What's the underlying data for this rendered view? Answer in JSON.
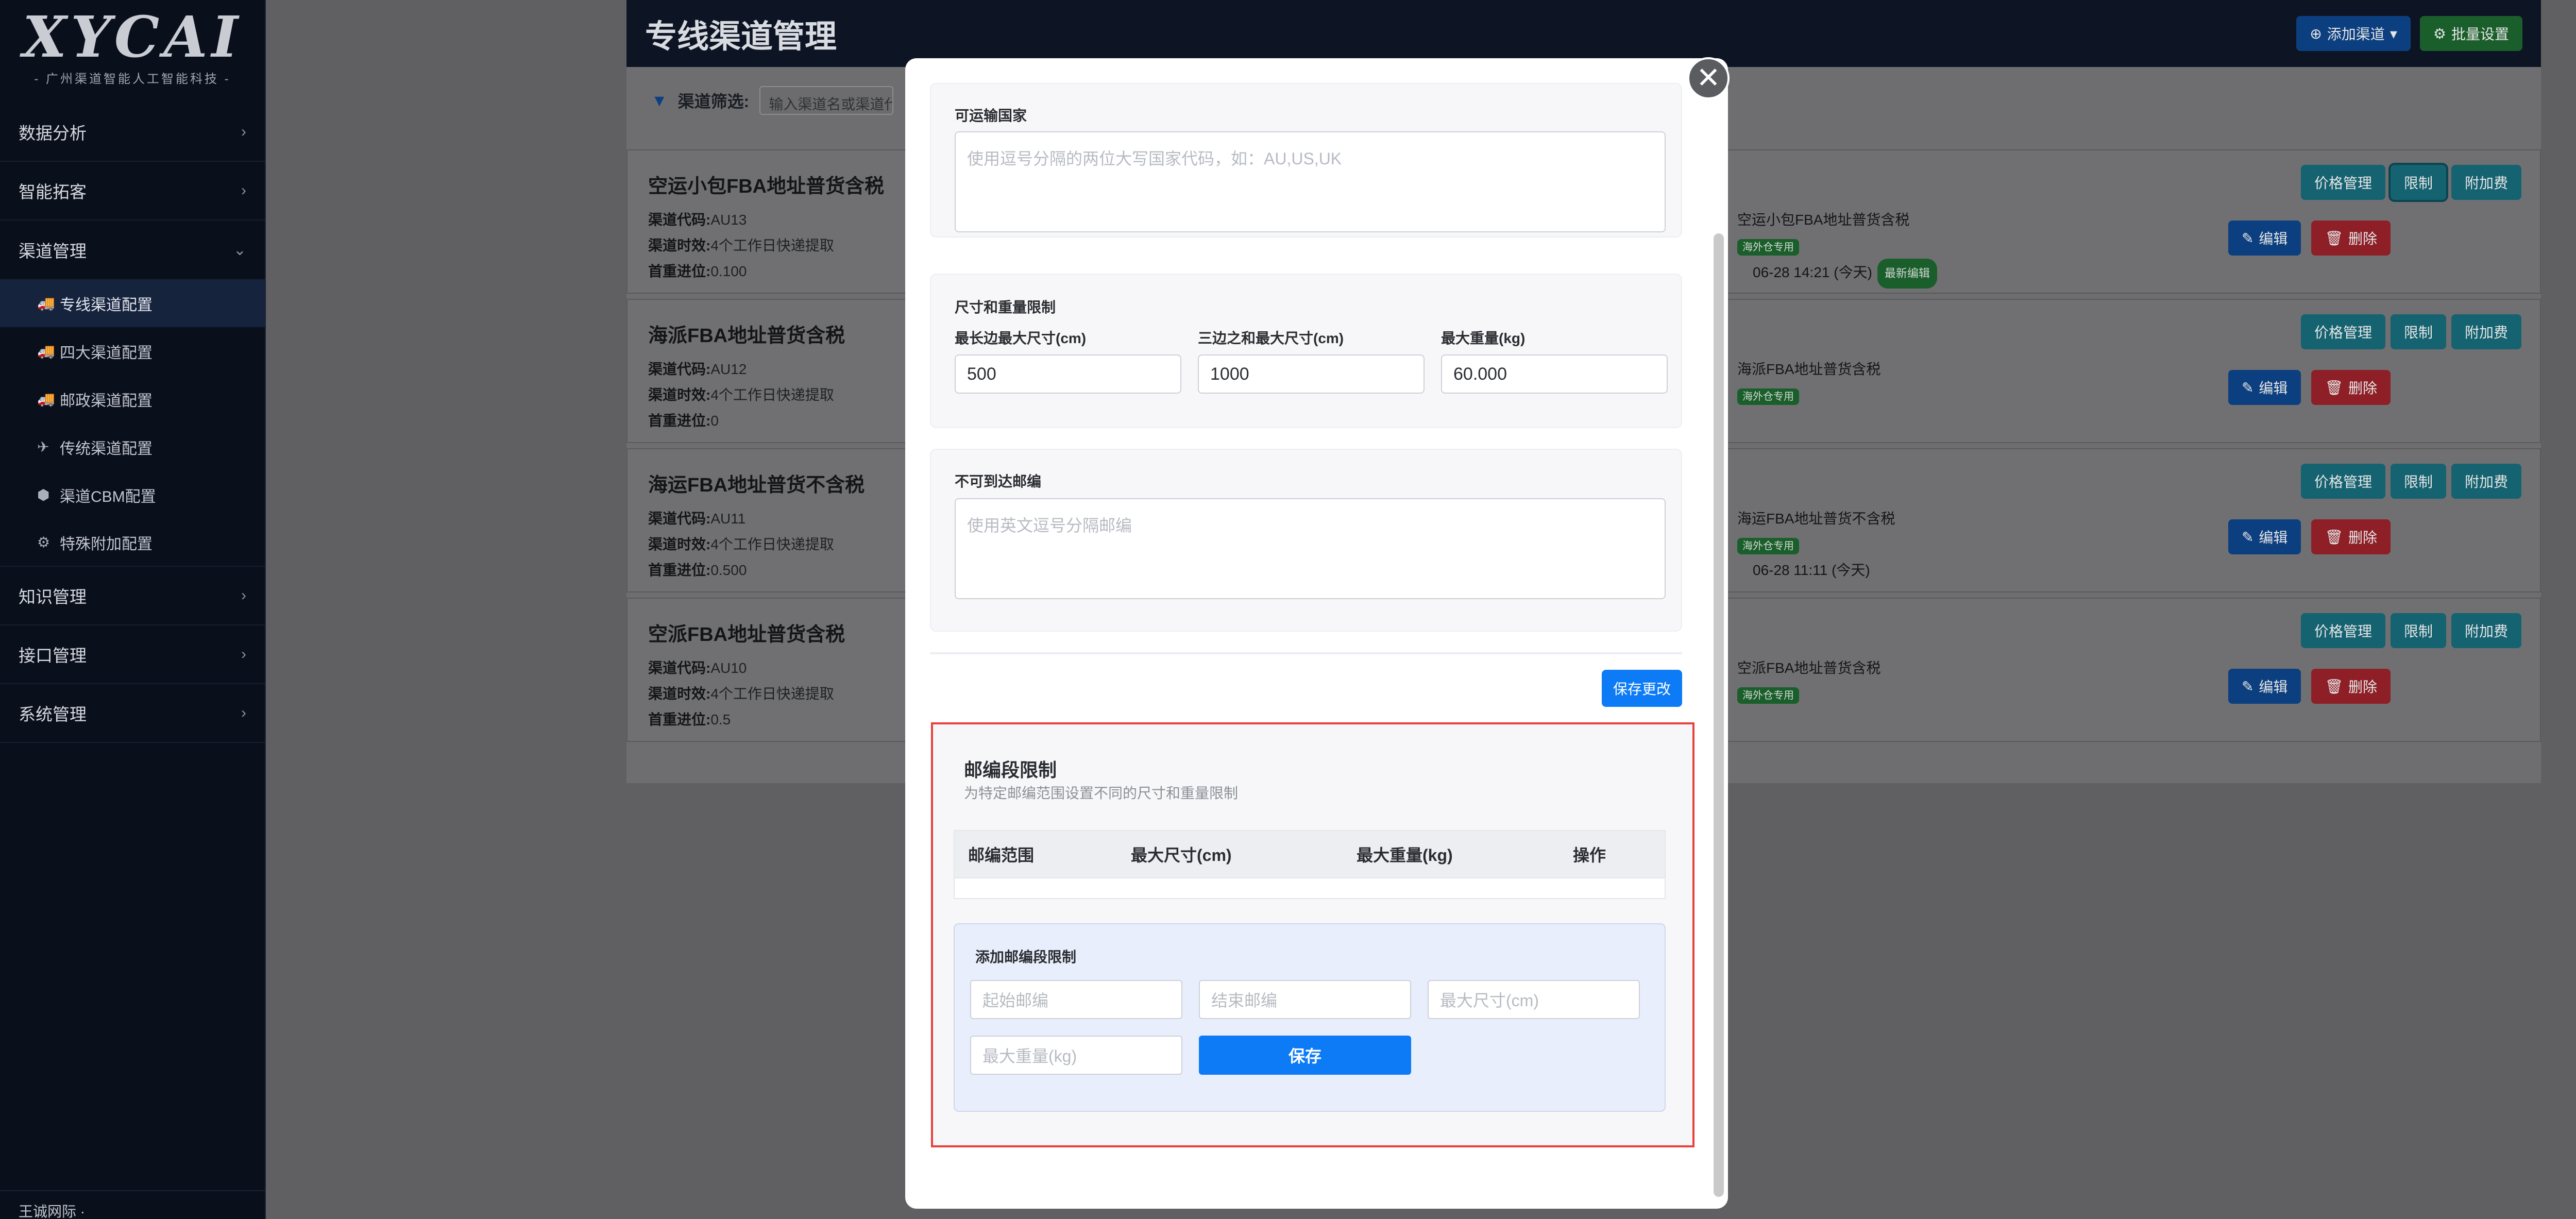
{
  "sidebar": {
    "logo_text": "XYCAI",
    "logo_sub": "- 广州渠道智能人工智能科技 -",
    "menu": [
      {
        "label": "数据分析",
        "chev": "›"
      },
      {
        "label": "智能拓客",
        "chev": "›"
      },
      {
        "label": "渠道管理",
        "chev": "⌄"
      }
    ],
    "submenu": [
      {
        "label": "专线渠道配置",
        "icon": "🚚"
      },
      {
        "label": "四大渠道配置",
        "icon": "🚚"
      },
      {
        "label": "邮政渠道配置",
        "icon": "🚚"
      },
      {
        "label": "传统渠道配置",
        "icon": "✈"
      },
      {
        "label": "渠道CBM配置",
        "icon": "⬢"
      },
      {
        "label": "特殊附加配置",
        "icon": "⚙"
      }
    ],
    "menu2": [
      {
        "label": "知识管理",
        "chev": "›"
      },
      {
        "label": "接口管理",
        "chev": "›"
      },
      {
        "label": "系统管理",
        "chev": "›"
      }
    ],
    "footer": "王诚网际 ·"
  },
  "page": {
    "title": "专线渠道管理",
    "add_channel": "添加渠道",
    "batch_settings": "批量设置",
    "filter_label": "渠道筛选:",
    "filter_placeholder": "输入渠道名或渠道代"
  },
  "cards": [
    {
      "title": "空运小包FBA地址普货含税",
      "code": "AU13",
      "time": "4个工作日快递提取",
      "weight": "0.100",
      "right_name": "空运小包FBA地址普货含税",
      "right_badge": "海外仓专用",
      "right_time": "06-28 14:21 (今天)",
      "right_latest": "最新编辑"
    },
    {
      "title": "海派FBA地址普货含税",
      "code": "AU12",
      "time": "4个工作日快递提取",
      "weight": "0",
      "right_name": "海派FBA地址普货含税",
      "right_badge": "海外仓专用",
      "right_time": "",
      "right_latest": ""
    },
    {
      "title": "海运FBA地址普货不含税",
      "code": "AU11",
      "time": "4个工作日快递提取",
      "weight": "0.500",
      "right_name": "海运FBA地址普货不含税",
      "right_badge": "海外仓专用",
      "right_time": "06-28 11:11 (今天)",
      "right_latest": ""
    },
    {
      "title": "空派FBA地址普货含税",
      "code": "AU10",
      "time": "4个工作日快递提取",
      "weight": "0.5",
      "right_name": "空派FBA地址普货含税",
      "right_badge": "海外仓专用",
      "right_time": "",
      "right_latest": ""
    }
  ],
  "card_labels": {
    "code": "渠道代码:",
    "time": "渠道时效:",
    "weight": "首重进位:",
    "price_mgmt": "价格管理",
    "limit": "限制",
    "surcharge": "附加费",
    "edit": "编辑",
    "delete": "删除"
  },
  "modal": {
    "close": "✕",
    "countries_label": "可运输国家",
    "countries_placeholder": "使用逗号分隔的两位大写国家代码，如：AU,US,UK",
    "size_section_label": "尺寸和重量限制",
    "max_side_label": "最长边最大尺寸(cm)",
    "max_side_value": "500",
    "sum_sides_label": "三边之和最大尺寸(cm)",
    "sum_sides_value": "1000",
    "max_weight_label": "最大重量(kg)",
    "max_weight_value": "60.000",
    "zip_exclude_label": "不可到达邮编",
    "zip_exclude_placeholder": "使用英文逗号分隔邮编",
    "save_changes": "保存更改",
    "zip_limit_title": "邮编段限制",
    "zip_limit_sub": "为特定邮编范围设置不同的尺寸和重量限制",
    "table_headers": [
      "邮编范围",
      "最大尺寸(cm)",
      "最大重量(kg)",
      "操作"
    ],
    "add_title": "添加邮编段限制",
    "start_zip_placeholder": "起始邮编",
    "end_zip_placeholder": "结束邮编",
    "max_size_placeholder": "最大尺寸(cm)",
    "max_weight_placeholder": "最大重量(kg)",
    "save": "保存"
  }
}
